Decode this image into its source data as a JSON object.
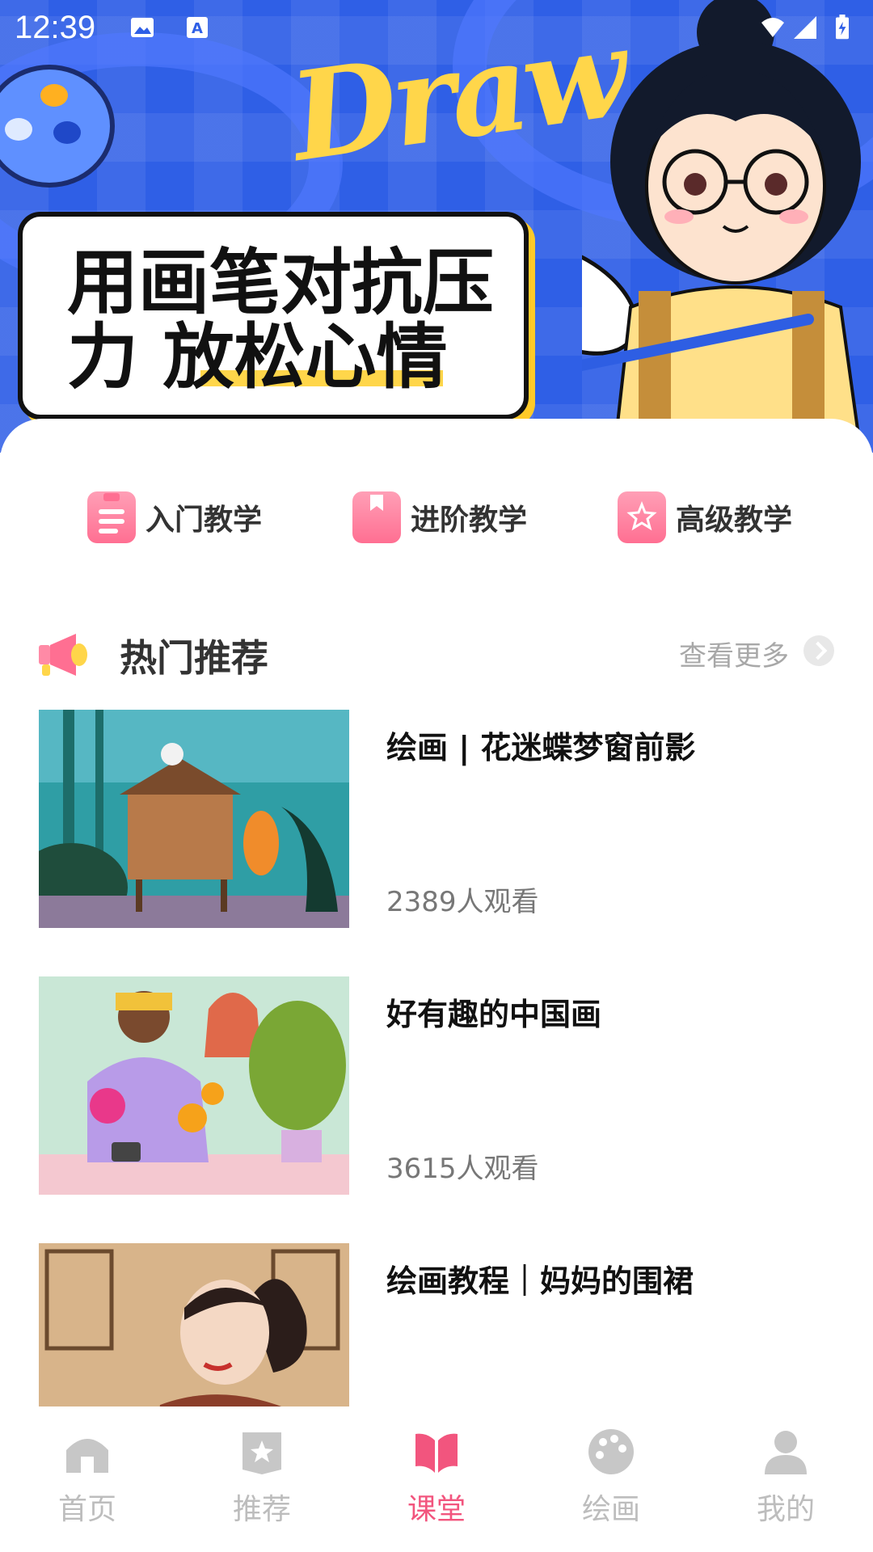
{
  "status_bar": {
    "time": "12:39"
  },
  "banner": {
    "word": "Draw",
    "line1": "用画笔对抗压",
    "line2": "力 放松心情"
  },
  "categories": [
    {
      "label": "入门教学",
      "icon": "clipboard-icon"
    },
    {
      "label": "进阶教学",
      "icon": "bookmark-book-icon"
    },
    {
      "label": "高级教学",
      "icon": "star-badge-icon"
    }
  ],
  "section": {
    "title": "热门推荐",
    "more": "查看更多"
  },
  "courses": [
    {
      "title": "绘画 | 花迷蝶梦窗前影",
      "views": "2389人观看"
    },
    {
      "title": "好有趣的中国画",
      "views": "3615人观看"
    },
    {
      "title": "绘画教程｜妈妈的围裙",
      "views": ""
    }
  ],
  "nav": {
    "tabs": [
      {
        "label": "首页",
        "icon": "home-icon"
      },
      {
        "label": "推荐",
        "icon": "star-bookmark-icon"
      },
      {
        "label": "课堂",
        "icon": "open-book-icon"
      },
      {
        "label": "绘画",
        "icon": "palette-icon"
      },
      {
        "label": "我的",
        "icon": "user-icon"
      }
    ],
    "active": "课堂"
  },
  "colors": {
    "accent": "#f2557e",
    "banner_blue": "#2f5fe6",
    "banner_yellow": "#ffd64a"
  }
}
